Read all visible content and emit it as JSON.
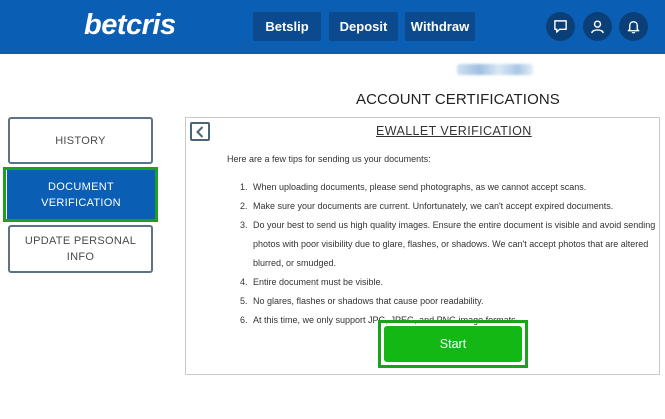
{
  "header": {
    "logo_text": "betcris",
    "betslip_label": "Betslip",
    "deposit_label": "Deposit",
    "withdraw_label": "Withdraw",
    "icons": [
      "chat-icon",
      "user-icon",
      "bell-icon"
    ],
    "brand_color": "#0a5fb4"
  },
  "page": {
    "title": "ACCOUNT CERTIFICATIONS"
  },
  "sidebar": {
    "items": [
      {
        "label_line1": "HISTORY",
        "label_line2": ""
      },
      {
        "label_line1": "DOCUMENT",
        "label_line2": "VERIFICATION",
        "active": true
      },
      {
        "label_line1": "UPDATE PERSONAL",
        "label_line2": "INFO"
      }
    ]
  },
  "panel": {
    "title": "EWALLET VERIFICATION",
    "intro": "Here are a few tips for sending us your documents:",
    "tips": [
      {
        "num": "1.",
        "lines": [
          "When uploading documents, please send photographs, as we cannot accept scans."
        ]
      },
      {
        "num": "2.",
        "lines": [
          "Make sure your documents are current. Unfortunately, we can't accept expired documents."
        ]
      },
      {
        "num": "3.",
        "lines": [
          "Do your best to send us high quality images. Ensure the entire document is visible and avoid sending",
          "photos with poor visibility due to glare, flashes, or shadows. We can't accept photos that are altered",
          "blurred, or smudged."
        ]
      },
      {
        "num": "4.",
        "lines": [
          "Entire document must be visible."
        ]
      },
      {
        "num": "5.",
        "lines": [
          "No glares, flashes or shadows that cause poor readability."
        ]
      },
      {
        "num": "6.",
        "lines": [
          "At this time, we only support JPG, JPEG, and PNG image formats."
        ]
      }
    ],
    "start_label": "Start",
    "highlight_color": "#1da11d",
    "start_color": "#14b814"
  }
}
